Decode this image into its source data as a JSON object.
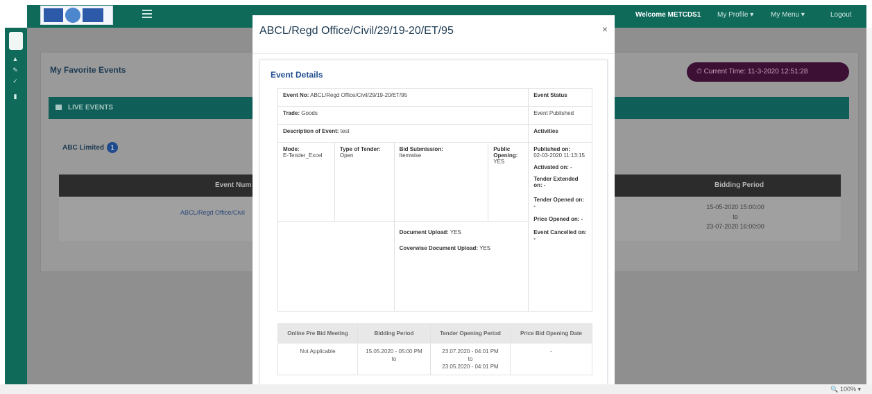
{
  "header": {
    "welcome": "Welcome METCDS1",
    "my_profile": "My Profile ▾",
    "my_menu": "My Menu ▾",
    "logout": "Logout"
  },
  "page": {
    "title": "My Favorite Events",
    "current_time": "⏱ Current Time: 11-3-2020 12:51:28",
    "live_events": "LIVE EVENTS",
    "org_name": "ABC Limited",
    "org_count": "1",
    "table": {
      "col_event": "Event Num",
      "col_bidding": "Bidding Period",
      "row_link": "ABCL/Regd Office/Civil",
      "row_bid_start": "15-05-2020 15:00:00",
      "row_bid_to": "to",
      "row_bid_end": "23-07-2020 16:00:00"
    }
  },
  "modal": {
    "title": "ABCL/Regd Office/Civil/29/19-20/ET/95",
    "close": "×",
    "section": "Event Details",
    "event_no_label": "Event No:",
    "event_no": "ABCL/Regd Office/Civil/29/19-20/ET/95",
    "event_status_label": "Event Status",
    "trade_label": "Trade:",
    "trade": "Goods",
    "event_status": "Event Published",
    "description_label": "Description of Event:",
    "description": "test",
    "activities_label": "Activities",
    "mode_label": "Mode:",
    "mode": "E-Tender_Excel",
    "tender_type_label": "Type of Tender:",
    "tender_type": "Open",
    "bid_submission_label": "Bid Submission:",
    "bid_submission": "Itemwise",
    "public_opening_label": "Public Opening:",
    "public_opening": "YES",
    "published_on_label": "Published on:",
    "published_on": "02-03-2020 11:13:15",
    "activated_on_label": "Activated on: -",
    "tender_extended_label": "Tender Extended on: -",
    "tender_opened_label": "Tender Opened on: -",
    "price_opened_label": "Price Opened on: -",
    "event_cancelled_label": "Event Cancelled on: -",
    "document_upload_label": "Document Upload:",
    "document_upload": "YES",
    "coverwise_label": "Coverwise Document Upload:",
    "coverwise": "YES",
    "bottom_table": {
      "headers": [
        "Online Pre Bid Meeting",
        "Bidding Period",
        "Tender Opening Period",
        "Price Bid Opening Date"
      ],
      "row": [
        "Not Applicable",
        "15.05.2020 - 05:00 PM",
        "23.07.2020 - 04:01 PM",
        "-"
      ],
      "bidding_to": "to",
      "opening_to": "to",
      "opening_end": "23.05.2020 - 04:01 PM"
    }
  },
  "statusbar": {
    "zoom": "🔍 100% ▾"
  }
}
